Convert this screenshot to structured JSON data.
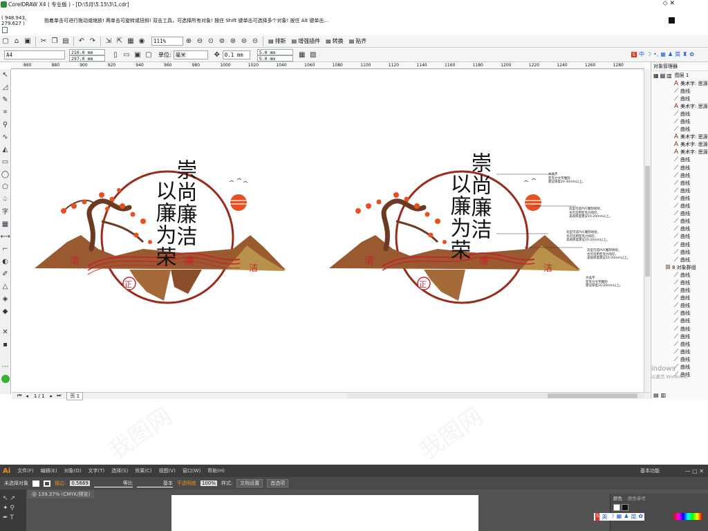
{
  "title_bar": {
    "title": "CorelDRAW X4 ( 专业版 ) - [D:\\5月\\5.15\\3\\1.cdr]"
  },
  "status_hint": {
    "coords": "( 948.943, 279.627 )",
    "message": "指着单击可进行拖动或缩放! 两单击可旋转或扭斜! 双击工具，可选择所有对象! 按住 Shift 键单击可选择多个对象! 按住 Alt 键单击..."
  },
  "toolbar": {
    "zoom": "111%",
    "buttons": [
      "排斯",
      "增强插件",
      "转换",
      "贴齐"
    ]
  },
  "property_bar": {
    "page_size": "A4",
    "width": "210.0 mm",
    "height": "297.0 mm",
    "units_label": "单位:",
    "units": "毫米",
    "nudge": "0.1 mm",
    "dup_x": "5.0 mm",
    "dup_y": "5.0 mm"
  },
  "ruler": {
    "ticks": [
      "860",
      "880",
      "900",
      "920",
      "940",
      "960",
      "980",
      "1000",
      "1020",
      "1040",
      "1060",
      "1080",
      "1100",
      "1120",
      "1140",
      "1160",
      "1180",
      "1200",
      "1220",
      "1240",
      "1260",
      "1280"
    ]
  },
  "artwork": {
    "title_line1": "崇尚廉洁",
    "title_line2": "以廉为荣",
    "seal1": "清",
    "seal2": "廉",
    "seal3": "正",
    "seal4": "洁",
    "notes": [
      "水晶字\n亚克力文字雕刻\n建议厚度20-30mm以上。",
      "造型可选PVC雕刻喷绘，\n也可选用亚克力喷印，\n美观厚度建议10-20mm以上。",
      "造型可选PVC雕刻喷绘，\n也可选用亚克力喷印，\n美观厚度建议10-20mm以上。",
      "造型可选PVC雕刻喷绘，\n也可选用亚克力喷印，\n美观厚度建议10-20mm以上。",
      "水晶字\n亚克力文字雕刻\n建议厚度10-20mm以上。"
    ]
  },
  "page_nav": {
    "position": "1 / 1",
    "page_tab": "页 1"
  },
  "object_manager": {
    "title": "对象管理器",
    "layer_label": "图层 1",
    "items": [
      {
        "type": "text",
        "label": "美术字: 思源"
      },
      {
        "type": "curve",
        "label": "曲线"
      },
      {
        "type": "curve",
        "label": "曲线"
      },
      {
        "type": "text",
        "label": "美术字: 思源"
      },
      {
        "type": "curve",
        "label": "曲线"
      },
      {
        "type": "curve",
        "label": "曲线"
      },
      {
        "type": "curve",
        "label": "曲线"
      },
      {
        "type": "text",
        "label": "美术字: 思源"
      },
      {
        "type": "text",
        "label": "美术字: 思源"
      },
      {
        "type": "text",
        "label": "美术字: 思源"
      },
      {
        "type": "curve",
        "label": "曲线"
      },
      {
        "type": "curve",
        "label": "曲线"
      },
      {
        "type": "curve",
        "label": "曲线"
      },
      {
        "type": "curve",
        "label": "曲线"
      },
      {
        "type": "curve",
        "label": "曲线"
      },
      {
        "type": "curve",
        "label": "曲线"
      },
      {
        "type": "curve",
        "label": "曲线"
      },
      {
        "type": "curve",
        "label": "曲线"
      },
      {
        "type": "curve",
        "label": "曲线"
      },
      {
        "type": "curve",
        "label": "曲线"
      },
      {
        "type": "curve",
        "label": "曲线"
      },
      {
        "type": "curve",
        "label": "曲线"
      },
      {
        "type": "curve",
        "label": "曲线"
      },
      {
        "type": "curve",
        "label": "曲线"
      },
      {
        "type": "group",
        "label": "8 对象群组"
      },
      {
        "type": "curve",
        "label": "曲线"
      },
      {
        "type": "curve",
        "label": "曲线"
      },
      {
        "type": "curve",
        "label": "曲线"
      },
      {
        "type": "curve",
        "label": "曲线"
      },
      {
        "type": "curve",
        "label": "曲线"
      },
      {
        "type": "curve",
        "label": "曲线"
      },
      {
        "type": "curve",
        "label": "曲线"
      },
      {
        "type": "curve",
        "label": "曲线"
      },
      {
        "type": "curve",
        "label": "曲线"
      },
      {
        "type": "curve",
        "label": "曲线"
      },
      {
        "type": "curve",
        "label": "曲线"
      },
      {
        "type": "curve",
        "label": "曲线"
      },
      {
        "type": "curve",
        "label": "曲线"
      },
      {
        "type": "curve",
        "label": "曲线"
      }
    ]
  },
  "activation": {
    "line1": "激活 Windows",
    "line2": "转到“设置”以激活 Windows。"
  },
  "ime": {
    "label": "中",
    "label2": "英"
  },
  "illustrator": {
    "logo": "Ai",
    "menu": [
      "文件(F)",
      "编辑(E)",
      "对象(O)",
      "文字(T)",
      "选择(S)",
      "效果(C)",
      "视图(V)",
      "窗口(W)",
      "帮助(H)"
    ],
    "workspace": "基本功能",
    "no_selection": "未选择对象",
    "stroke_label": "描边:",
    "stroke_value": "0.5669",
    "stroke_style1": "等比",
    "stroke_style2": "基本",
    "opacity_label": "不透明度",
    "opacity_value": "100%",
    "style_label": "样式:",
    "doc_setup": "文档设置",
    "prefs": "首选项",
    "tab": "@ 139.37% (CMYK/预览)",
    "panel_tab1": "颜色",
    "panel_tab2": "颜色参考"
  },
  "colors": {
    "brand_red": "#c1272d",
    "brown": "#6b3a22",
    "orange": "#e8501f",
    "gold": "#b8914a",
    "ai_dark": "#3c3c3c",
    "ai_orange": "#e8911f"
  }
}
